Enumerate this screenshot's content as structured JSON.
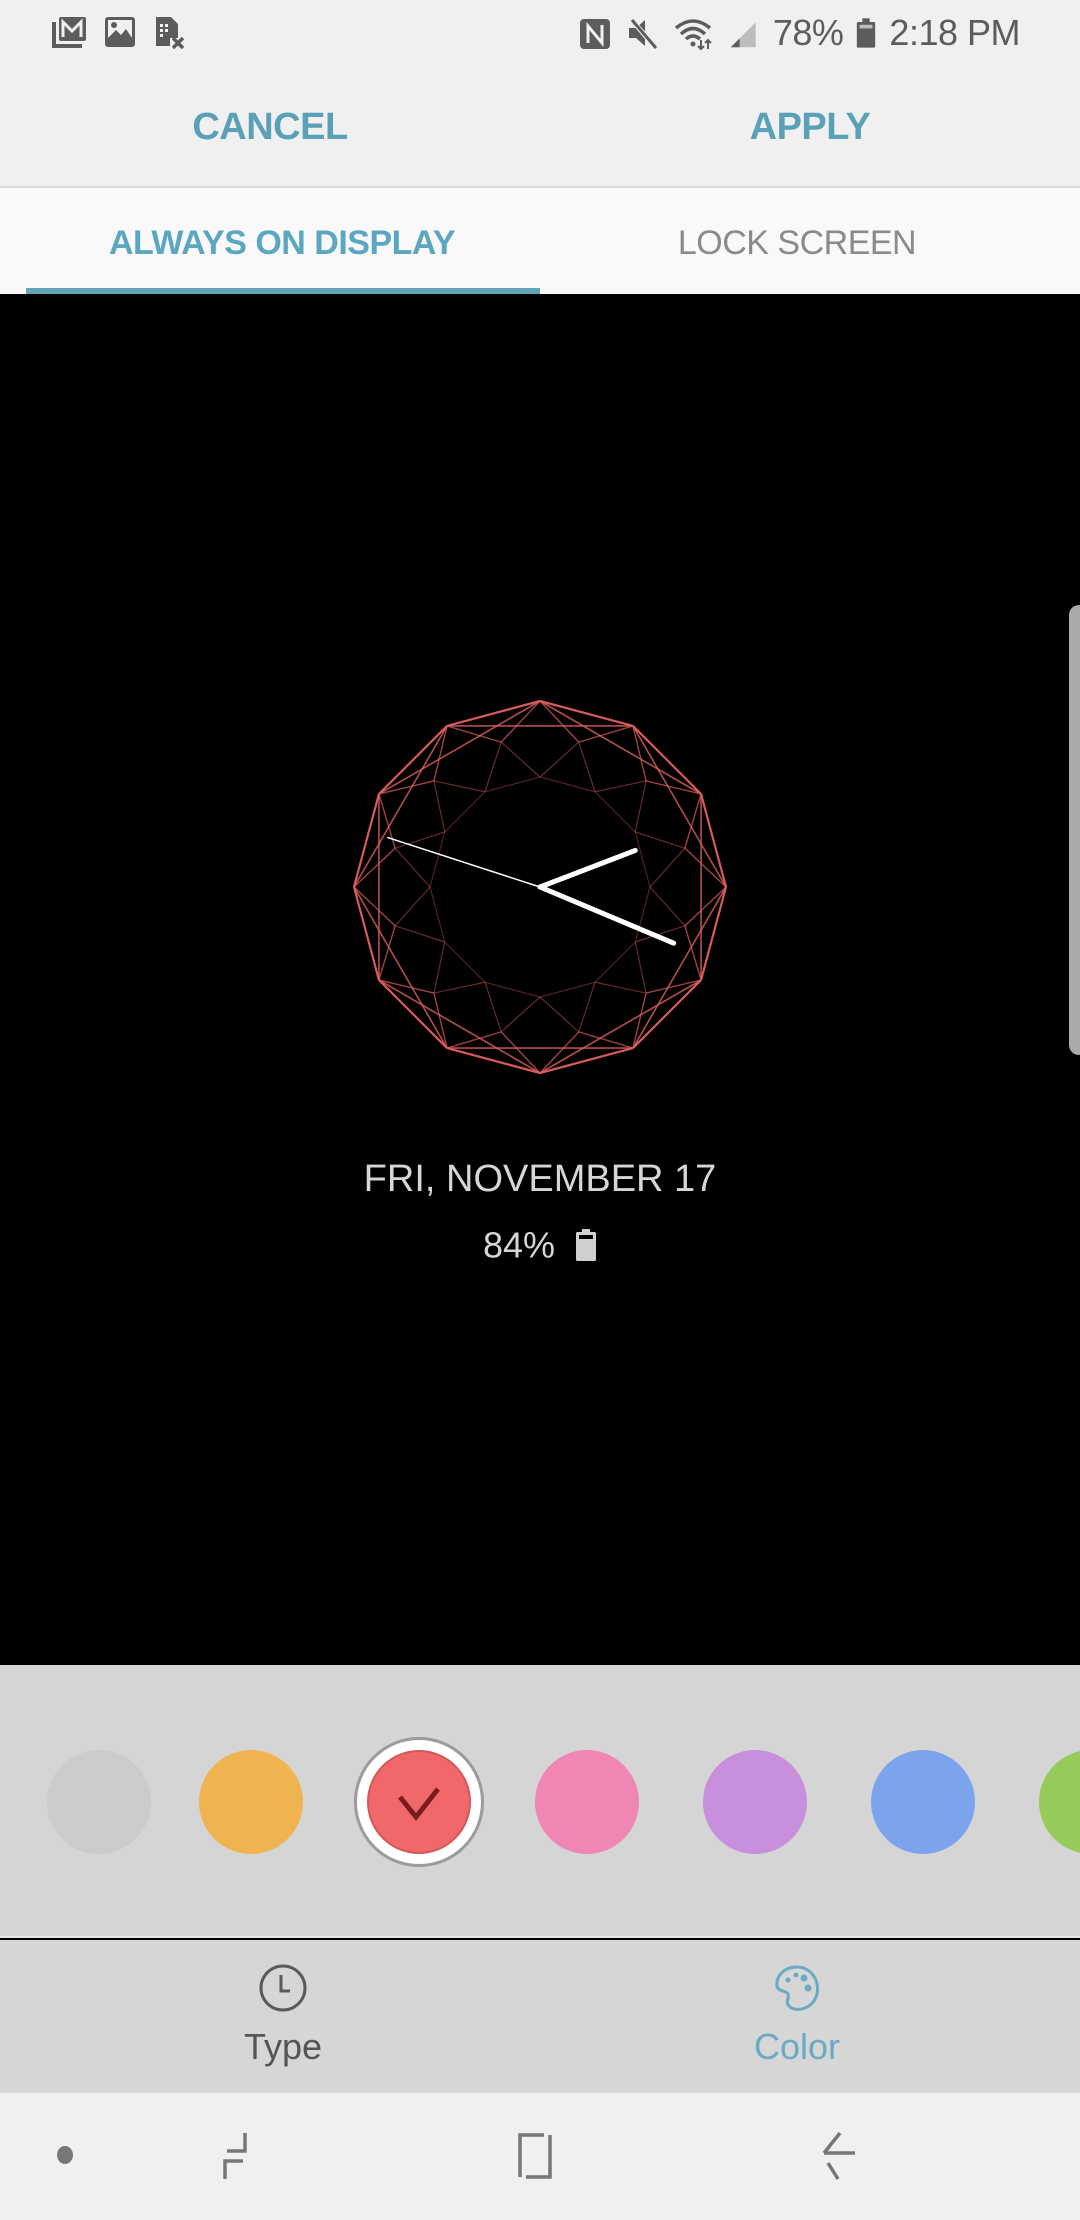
{
  "status_bar": {
    "left_icons": [
      "gmail-icon",
      "gallery-icon",
      "no-sim-icon"
    ],
    "right_icons": [
      "nfc-icon",
      "mute-icon",
      "wifi-icon",
      "signal-icon"
    ],
    "battery_percent": "78%",
    "time": "2:18 PM"
  },
  "action_bar": {
    "cancel_label": "CANCEL",
    "apply_label": "APPLY",
    "accent_color": "#5aa0b7"
  },
  "tabs": [
    {
      "label": "ALWAYS ON DISPLAY",
      "active": true
    },
    {
      "label": "LOCK SCREEN",
      "active": false
    }
  ],
  "preview": {
    "clock_style": "dodecagon-wireframe",
    "clock_color": "#e06060",
    "clock_time": {
      "hour": 2,
      "minute": 18,
      "second": 48
    },
    "date": "FRI, NOVEMBER 17",
    "battery": "84%"
  },
  "colors": {
    "swatches": [
      {
        "name": "gray",
        "hex": "#cbcbcb",
        "selected": false
      },
      {
        "name": "orange",
        "hex": "#efb450",
        "selected": false
      },
      {
        "name": "red",
        "hex": "#f0686a",
        "selected": true
      },
      {
        "name": "pink",
        "hex": "#f086b4",
        "selected": false
      },
      {
        "name": "purple",
        "hex": "#c78fdc",
        "selected": false
      },
      {
        "name": "blue",
        "hex": "#7ba4ed",
        "selected": false
      },
      {
        "name": "green",
        "hex": "#94cb5a",
        "selected": false
      }
    ]
  },
  "bottom_tabs": [
    {
      "label": "Type",
      "icon": "clock-icon",
      "active": false
    },
    {
      "label": "Color",
      "icon": "palette-icon",
      "active": true
    }
  ],
  "nav_bar": {
    "buttons": [
      "dot-indicator",
      "recents-icon",
      "home-icon",
      "back-icon"
    ]
  }
}
